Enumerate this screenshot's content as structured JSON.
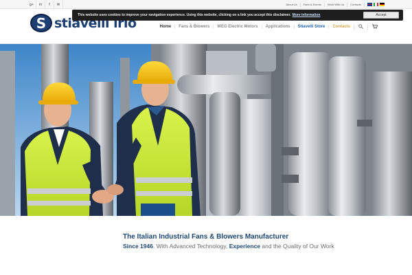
{
  "topbar": {
    "social_icons": [
      {
        "icon": "googleplus-icon",
        "glyph": "g+"
      },
      {
        "icon": "linkedin-icon",
        "glyph": "in"
      },
      {
        "icon": "facebook-icon",
        "glyph": "f"
      },
      {
        "icon": "mail-icon",
        "glyph": "✉"
      }
    ],
    "links": [
      "About Us",
      "Fairs & Events",
      "Work With Us",
      "Contacts"
    ],
    "flags": [
      "english-flag",
      "italian-flag",
      "german-flag"
    ]
  },
  "cookie": {
    "text": "This website uses cookies to improve your navigation experience. Using this website, clicking on a link you accept this disclaimer.",
    "link": "More information",
    "accept": "Accept"
  },
  "header": {
    "logo_mark": "S",
    "logo_text": "stiavelli irio",
    "nav": [
      "Home",
      "Fans & Blowers",
      "WEG Electric Motors",
      "Applications",
      "Stiavelli Store",
      "Contacts"
    ],
    "search_icon": "🔍",
    "cart_icon": "🛒"
  },
  "tagline": {
    "title": "The Italian Industrial Fans & Blowers Manufacturer",
    "since": "Since 1946",
    "mid": ". With Advanced Technology, ",
    "experience": "Experience",
    "end": " and the Quality of Our Work"
  },
  "colors": {
    "brand_blue": "#1d3f72",
    "store_blue": "#1d62a8",
    "contacts_gold": "#d8a64a",
    "cookie_bg": "#1e1e1e"
  }
}
